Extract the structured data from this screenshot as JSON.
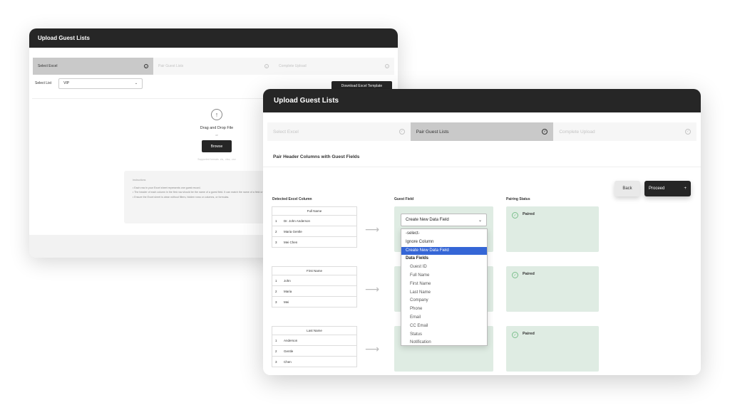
{
  "back_window": {
    "title": "Upload Guest Lists",
    "steps": [
      {
        "label": "Select Excel",
        "active": true
      },
      {
        "label": "Pair Guest Lists",
        "active": false
      },
      {
        "label": "Complete Upload",
        "active": false
      }
    ],
    "select_list_label": "Select List",
    "select_list_value": "VIP",
    "download_template_label": "Download Excel Template",
    "drop_title": "Drag and Drop File",
    "drop_or": "or",
    "browse_label": "Browse",
    "supported_formats": "Supported formats .xls, .xlsx, .csv",
    "instructions_heading": "Instructions",
    "instructions": [
      "• Each row in your Excel sheet represents one guest record.",
      "• The header of each column in the first row should be the name of a guest field. It can match the name of a field or a custom field, e.g. Company, Title.",
      "• Ensure the Excel sheet is clean without filters, hidden rows or columns, or formulas."
    ]
  },
  "front_window": {
    "title": "Upload Guest Lists",
    "steps": [
      {
        "label": "Select Excel",
        "active": false
      },
      {
        "label": "Pair Guest Lists",
        "active": true
      },
      {
        "label": "Complete Upload",
        "active": false
      }
    ],
    "section_title": "Pair Header Columns with Guest Fields",
    "back_label": "Back",
    "proceed_label": "Proceed",
    "proceed_icon": "+",
    "col_detected": "Detected Excel Column",
    "col_guest_field": "Guest Field",
    "col_pairing_status": "Pairing Status",
    "tables": [
      {
        "header": "Full Name",
        "rows": [
          [
            "1",
            "Dr. John Anderson"
          ],
          [
            "2",
            "Maria Gentle"
          ],
          [
            "3",
            "Mei Chen"
          ]
        ]
      },
      {
        "header": "First Name",
        "rows": [
          [
            "1",
            "John"
          ],
          [
            "2",
            "Maria"
          ],
          [
            "3",
            "Mei"
          ]
        ]
      },
      {
        "header": "Last Name",
        "rows": [
          [
            "1",
            "Anderson"
          ],
          [
            "2",
            "Gentle"
          ],
          [
            "3",
            "Chen"
          ]
        ]
      }
    ],
    "select_value": "Create New Data Field",
    "dropdown_options": [
      {
        "label": "-select-",
        "type": "opt"
      },
      {
        "label": "Ignore Column",
        "type": "opt"
      },
      {
        "label": "Create New Data Field",
        "type": "selected"
      },
      {
        "label": "Data Fields",
        "type": "group"
      },
      {
        "label": "Guest ID",
        "type": "sub"
      },
      {
        "label": "Full Name",
        "type": "sub"
      },
      {
        "label": "First Name",
        "type": "sub"
      },
      {
        "label": "Last Name",
        "type": "sub"
      },
      {
        "label": "Company",
        "type": "sub"
      },
      {
        "label": "Phone",
        "type": "sub"
      },
      {
        "label": "Email",
        "type": "sub"
      },
      {
        "label": "CC Email",
        "type": "sub"
      },
      {
        "label": "Status",
        "type": "sub"
      },
      {
        "label": "Notification",
        "type": "sub"
      }
    ],
    "status_label": "Paired"
  }
}
